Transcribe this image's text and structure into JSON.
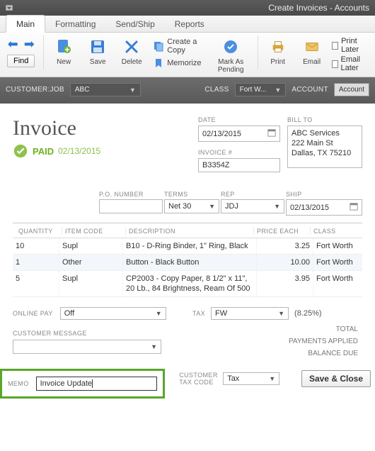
{
  "window": {
    "title": "Create Invoices - Accounts"
  },
  "tabs": {
    "main": "Main",
    "formatting": "Formatting",
    "sendship": "Send/Ship",
    "reports": "Reports"
  },
  "toolbar": {
    "find": "Find",
    "new": "New",
    "save": "Save",
    "delete": "Delete",
    "create_copy": "Create a Copy",
    "memorize": "Memorize",
    "mark_pending": "Mark As Pending",
    "print": "Print",
    "email": "Email",
    "print_later": "Print Later",
    "email_later": "Email Later"
  },
  "custbar": {
    "customer_label": "CUSTOMER:JOB",
    "customer_value": "ABC",
    "class_label": "CLASS",
    "class_value": "Fort W...",
    "account_label": "ACCOUNT",
    "account_value": "Account"
  },
  "invoice": {
    "title": "Invoice",
    "paid_label": "PAID",
    "paid_date": "02/13/2015"
  },
  "header_fields": {
    "date_label": "DATE",
    "date_value": "02/13/2015",
    "invoice_no_label": "INVOICE #",
    "invoice_no_value": "B3354Z",
    "billto_label": "BILL TO",
    "billto_value": "ABC Services\n222 Main St\nDallas, TX 75210"
  },
  "meta": {
    "po_label": "P.O. NUMBER",
    "po_value": "",
    "terms_label": "TERMS",
    "terms_value": "Net 30",
    "rep_label": "REP",
    "rep_value": "JDJ",
    "ship_label": "SHIP",
    "ship_value": "02/13/2015"
  },
  "table": {
    "headers": {
      "qty": "QUANTITY",
      "item": "ITEM CODE",
      "desc": "DESCRIPTION",
      "price": "PRICE EACH",
      "class": "CLASS"
    },
    "rows": [
      {
        "qty": "10",
        "item": "Supl",
        "desc": "B10 - D-Ring Binder, 1\" Ring, Black",
        "price": "3.25",
        "class": "Fort Worth"
      },
      {
        "qty": "1",
        "item": "Other",
        "desc": "Button - Black Button",
        "price": "10.00",
        "class": "Fort Worth"
      },
      {
        "qty": "5",
        "item": "Supl",
        "desc": "CP2003 - Copy Paper, 8 1/2\" x 11\", 20 Lb., 84 Brightness, Ream Of 500",
        "price": "3.95",
        "class": "Fort Worth"
      }
    ]
  },
  "lower": {
    "online_pay_label": "ONLINE PAY",
    "online_pay_value": "Off",
    "customer_message_label": "CUSTOMER MESSAGE",
    "tax_label": "TAX",
    "tax_value": "FW",
    "tax_rate": "(8.25%)",
    "total_label": "TOTAL",
    "payments_applied_label": "PAYMENTS APPLIED",
    "balance_due_label": "BALANCE DUE"
  },
  "memo": {
    "label": "MEMO",
    "value": "Invoice Update"
  },
  "bottom": {
    "customer_tax_code_label": "CUSTOMER TAX CODE",
    "customer_tax_code_value": "Tax",
    "save_close": "Save & Close"
  }
}
